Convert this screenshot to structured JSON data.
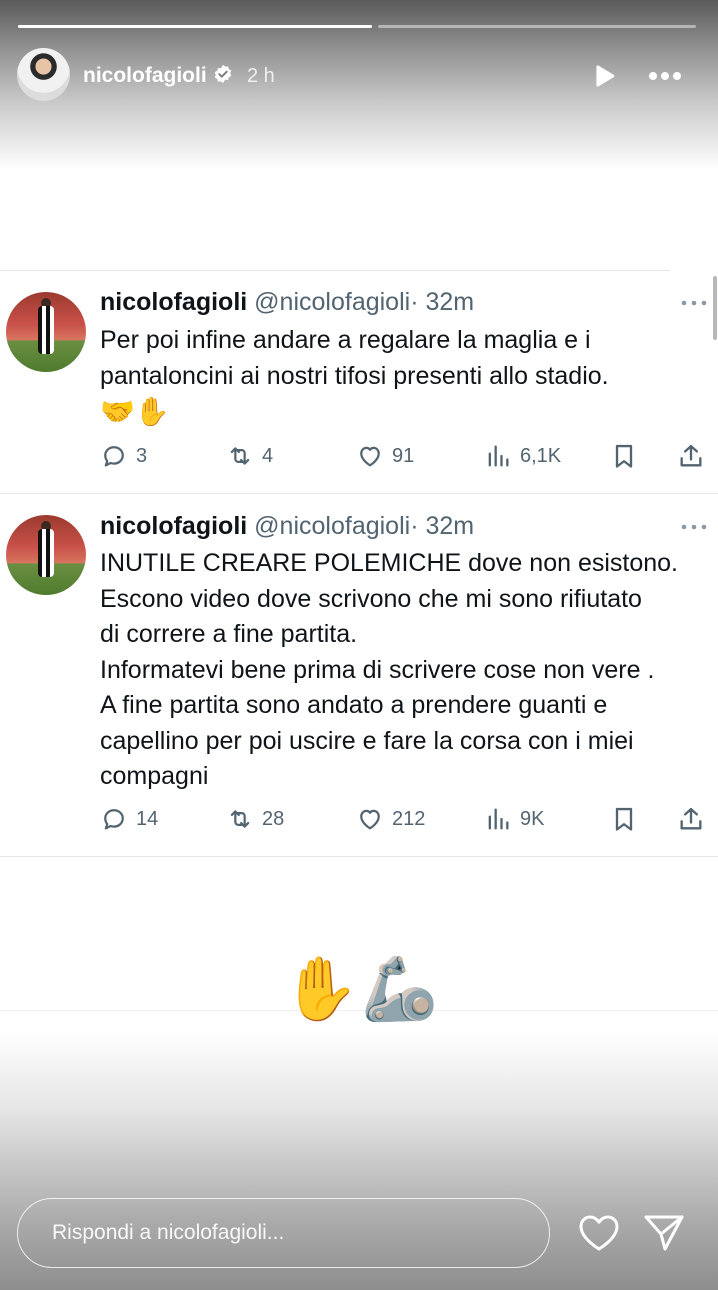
{
  "story": {
    "progress": [
      1.0,
      0.0
    ],
    "username": "nicolofagioli",
    "time": "2 h",
    "icons": [
      "verified-icon",
      "play-icon",
      "more-icon"
    ]
  },
  "tweets": [
    {
      "name": "nicolofagioli",
      "handle": "@nicolofagioli",
      "time": "· 32m",
      "text": [
        "Per poi infine andare a regalare la maglia e i",
        "pantaloncini ai nostri tifosi presenti allo stadio."
      ],
      "emoji": "🤝✋",
      "replies": "3",
      "retweets": "4",
      "likes": "91",
      "views": "6,1K"
    },
    {
      "name": "nicolofagioli",
      "handle": "@nicolofagioli",
      "time": "· 32m",
      "text": [
        "INUTILE CREARE POLEMICHE dove non esistono.",
        "Escono video dove scrivono che mi sono rifiutato",
        "di correre a fine partita.",
        "Informatevi bene prima di scrivere cose non vere .",
        "A fine partita sono andato a prendere guanti e",
        "capellino per poi uscire e fare la corsa con i miei",
        "compagni"
      ],
      "replies": "14",
      "retweets": "28",
      "likes": "212",
      "views": "9K"
    }
  ],
  "sticker_emoji": "✋🦾",
  "reply": {
    "placeholder": "Rispondi a nicolofagioli..."
  },
  "colors": {
    "text": "#0f1419",
    "muted": "#536471",
    "verified": "#ffffff"
  }
}
